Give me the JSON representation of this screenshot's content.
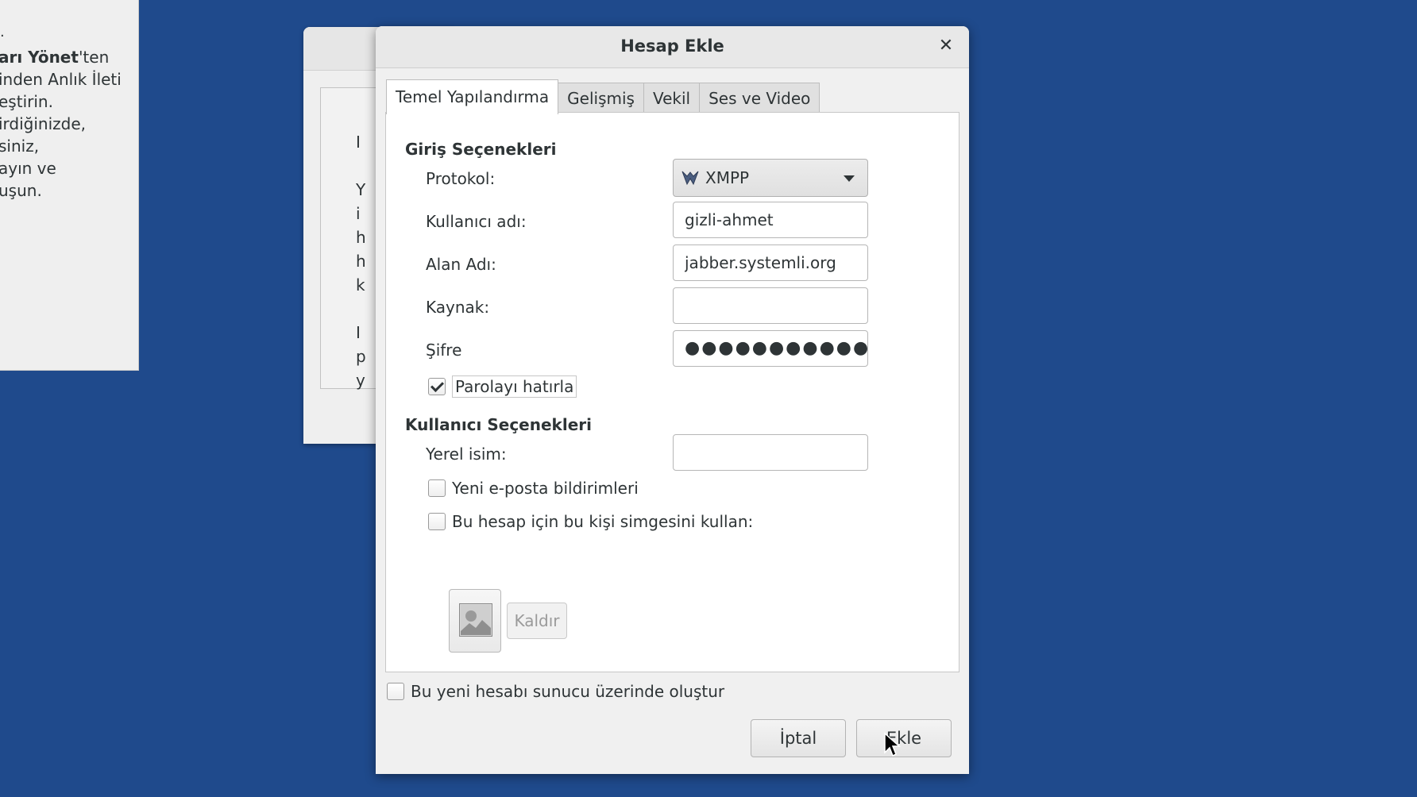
{
  "background_left": {
    "dot": ".",
    "lines": [
      {
        "bold": "arı Yönet",
        "rest": "'ten"
      },
      {
        "bold": "",
        "rest": "inden Anlık İleti"
      },
      {
        "bold": "",
        "rest": "eştirin."
      },
      {
        "bold": "",
        "rest": "irdiğinizde,"
      },
      {
        "bold": "",
        "rest": "siniz,"
      },
      {
        "bold": "",
        "rest": "ayın ve"
      },
      {
        "bold": "",
        "rest": "uşun."
      }
    ]
  },
  "background_mid": {
    "glyphs": [
      "I",
      "",
      "Y",
      "i",
      "h",
      "h",
      "k",
      "",
      "I",
      "p",
      "y"
    ]
  },
  "dialog": {
    "title": "Hesap Ekle",
    "close_glyph": "✕",
    "tabs": [
      {
        "label": "Temel Yapılandırma",
        "active": true
      },
      {
        "label": "Gelişmiş",
        "active": false
      },
      {
        "label": "Vekil",
        "active": false
      },
      {
        "label": "Ses ve Video",
        "active": false
      }
    ],
    "login_section": "Giriş Seçenekleri",
    "protocol_label": "Protokol:",
    "protocol_value": "XMPP",
    "protocol_icon": "xmpp-icon",
    "username_label": "Kullanıcı adı:",
    "username_value": "gizli-ahmet",
    "domain_label": "Alan Adı:",
    "domain_value": "jabber.systemli.org",
    "resource_label": "Kaynak:",
    "resource_value": "",
    "password_label": "Şifre",
    "password_value": "●●●●●●●●●●●",
    "remember_password_label": "Parolayı hatırla",
    "remember_password_checked": true,
    "user_section": "Kullanıcı Seçenekleri",
    "local_alias_label": "Yerel isim:",
    "local_alias_value": "",
    "new_mail_label": "Yeni e-posta bildirimleri",
    "new_mail_checked": false,
    "buddy_icon_label": "Bu hesap için bu kişi simgesini kullan:",
    "buddy_icon_checked": false,
    "remove_label": "Kaldır",
    "register_label": "Bu yeni hesabı sunucu üzerinde oluştur",
    "register_checked": false,
    "cancel_label": "İptal",
    "add_label": "Ekle"
  },
  "colors": {
    "desktop": "#1f4a8c",
    "dialog_bg": "#f0f0f0",
    "text": "#2e3436"
  }
}
